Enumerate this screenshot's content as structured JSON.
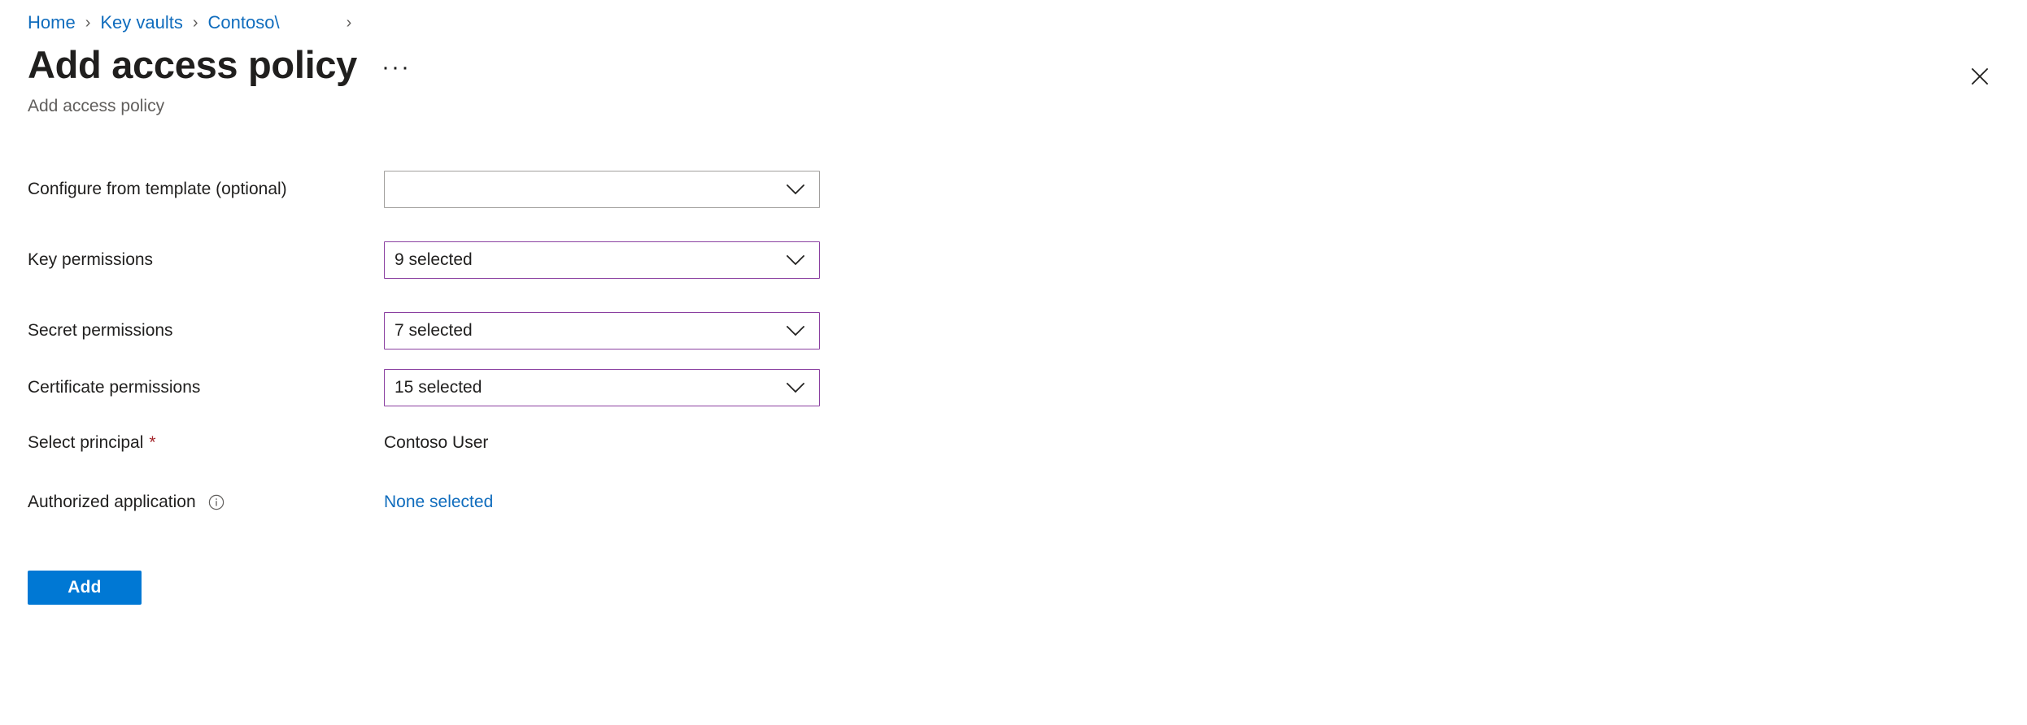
{
  "breadcrumb": {
    "items": [
      {
        "label": "Home",
        "type": "link"
      },
      {
        "label": "Key vaults",
        "type": "link"
      },
      {
        "label": "Contoso\\",
        "type": "link-truncated"
      }
    ],
    "separator": "›",
    "trailing_separator": "›"
  },
  "header": {
    "title": "Add access policy",
    "ellipsis_label": "···",
    "subtitle": "Add access policy",
    "close_icon": "close-icon"
  },
  "form": {
    "rows": [
      {
        "label": "Configure from template (optional)",
        "required": false,
        "control": "dropdown",
        "value": "",
        "accent": false,
        "chevron_icon": "chevron-down-icon",
        "name": "configure-from-template"
      },
      {
        "label": "Key permissions",
        "required": false,
        "control": "dropdown",
        "value": "9 selected",
        "accent": true,
        "chevron_icon": "chevron-down-icon",
        "name": "key-permissions"
      },
      {
        "label": "Secret permissions",
        "required": false,
        "control": "dropdown",
        "value": "7 selected",
        "accent": true,
        "chevron_icon": "chevron-down-icon",
        "name": "secret-permissions"
      },
      {
        "label": "Certificate permissions",
        "required": false,
        "control": "dropdown",
        "value": "15 selected",
        "accent": true,
        "chevron_icon": "chevron-down-icon",
        "name": "certificate-permissions"
      },
      {
        "label": "Select principal",
        "required": true,
        "required_marker": "*",
        "control": "static",
        "value": "Contoso User",
        "name": "select-principal"
      },
      {
        "label": "Authorized application",
        "required": false,
        "info_icon": "info-icon",
        "control": "link",
        "value": "None selected",
        "name": "authorized-application"
      }
    ]
  },
  "actions": {
    "add_label": "Add"
  },
  "colors": {
    "accent_blue": "#0078d4",
    "link_blue": "#0f6cbd",
    "field_accent_purple": "#8a3fa0",
    "required_red": "#a4262c",
    "border_gray": "#a19f9d",
    "subtitle_gray": "#605e5c",
    "text": "#201f1e"
  }
}
